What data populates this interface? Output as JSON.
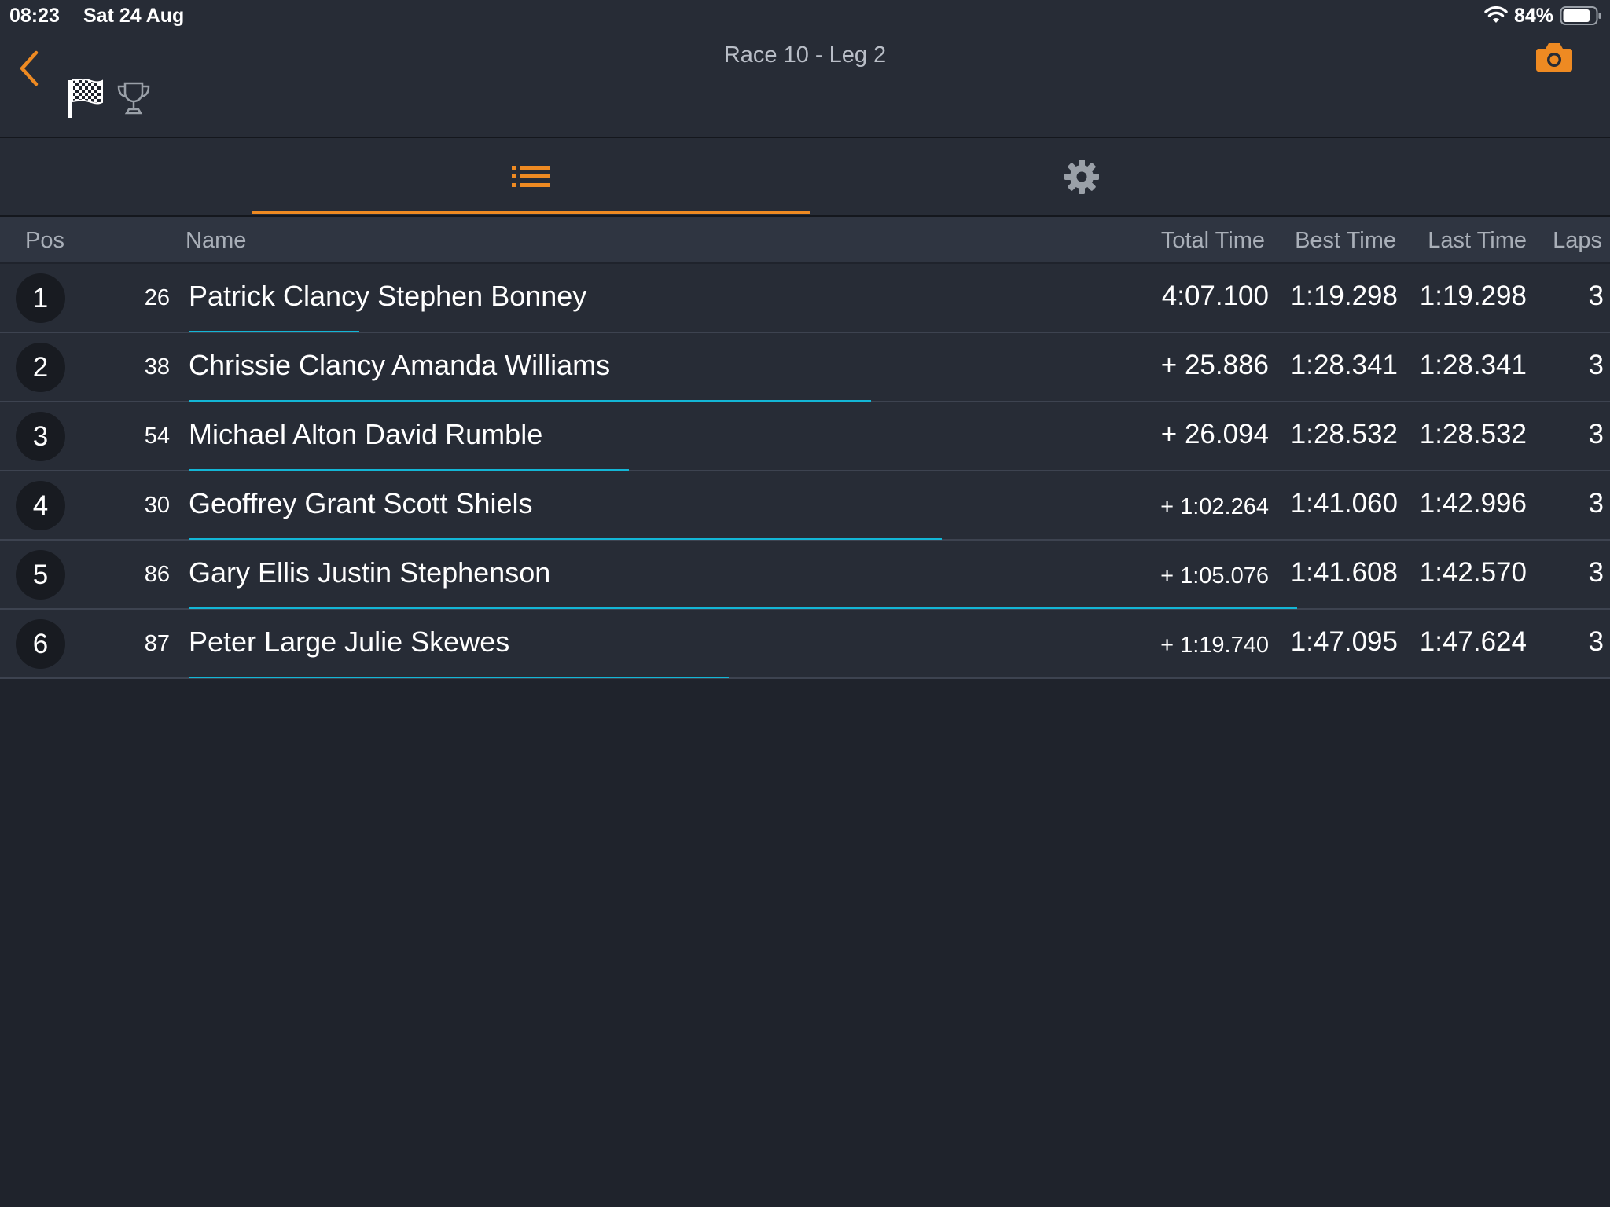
{
  "status_bar": {
    "time": "08:23",
    "date": "Sat 24 Aug",
    "battery": "84%",
    "battery_level": 0.84,
    "wifi_icon": "wifi-icon",
    "battery_icon": "battery-icon"
  },
  "nav": {
    "title": "Race 10 - Leg 2",
    "back_icon": "chevron-left-icon",
    "flag_icon": "checkered-flag-icon",
    "trophy_icon": "trophy-icon",
    "camera_icon": "camera-icon"
  },
  "tabs": [
    {
      "icon": "list-icon",
      "selected": true
    },
    {
      "icon": "gear-icon",
      "selected": false
    }
  ],
  "table": {
    "headers": {
      "pos": "Pos",
      "name": "Name",
      "total_time": "Total Time",
      "best_time": "Best Time",
      "last_time": "Last Time",
      "laps": "Laps"
    },
    "rows": [
      {
        "pos": "1",
        "number": "26",
        "name": "Patrick Clancy Stephen Bonney",
        "total_time": "4:07.100",
        "best_time": "1:19.298",
        "last_time": "1:19.298",
        "laps": "3",
        "progress": 0.12
      },
      {
        "pos": "2",
        "number": "38",
        "name": "Chrissie Clancy Amanda Williams",
        "total_time": "+ 25.886",
        "best_time": "1:28.341",
        "last_time": "1:28.341",
        "laps": "3",
        "progress": 0.48
      },
      {
        "pos": "3",
        "number": "54",
        "name": "Michael Alton David Rumble",
        "total_time": "+ 26.094",
        "best_time": "1:28.532",
        "last_time": "1:28.532",
        "laps": "3",
        "progress": 0.31
      },
      {
        "pos": "4",
        "number": "30",
        "name": "Geoffrey Grant Scott Shiels",
        "total_time": "+ 1:02.264",
        "best_time": "1:41.060",
        "last_time": "1:42.996",
        "laps": "3",
        "progress": 0.53
      },
      {
        "pos": "5",
        "number": "86",
        "name": "Gary Ellis Justin Stephenson",
        "total_time": "+ 1:05.076",
        "best_time": "1:41.608",
        "last_time": "1:42.570",
        "laps": "3",
        "progress": 0.78
      },
      {
        "pos": "6",
        "number": "87",
        "name": "Peter Large Julie Skewes",
        "total_time": "+ 1:19.740",
        "best_time": "1:47.095",
        "last_time": "1:47.624",
        "laps": "3",
        "progress": 0.38
      }
    ]
  },
  "colors": {
    "accent": "#ee8a22",
    "progress": "#13b6d6",
    "background": "#1f232c",
    "row_background": "#272c36"
  }
}
